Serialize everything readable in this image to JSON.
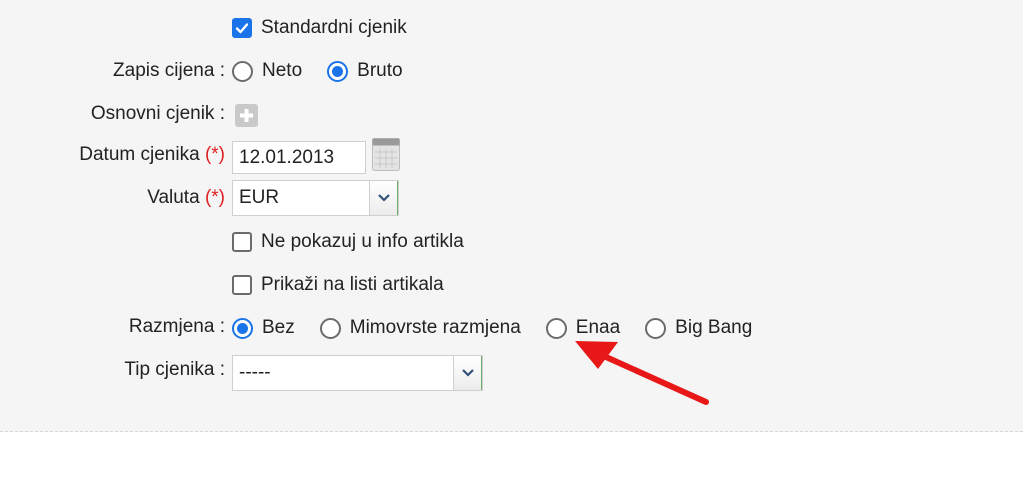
{
  "form": {
    "standardni_cjenik": {
      "label": "Standardni cjenik",
      "checked": true
    },
    "zapis_cijena": {
      "label": "Zapis cijena :",
      "options": [
        {
          "label": "Neto",
          "selected": false
        },
        {
          "label": "Bruto",
          "selected": true
        }
      ]
    },
    "osnovni_cjenik": {
      "label": "Osnovni cjenik :",
      "icon": "plus-icon"
    },
    "datum_cjenika": {
      "label": "Datum cjenika",
      "required_mark": "(*)",
      "colon": ":",
      "value": "12.01.2013",
      "icon": "calendar-icon"
    },
    "valuta": {
      "label": "Valuta",
      "required_mark": "(*)",
      "colon": ":",
      "value": "EUR"
    },
    "ne_pokazuj": {
      "label": "Ne pokazuj u info artikla",
      "checked": false
    },
    "prikazi": {
      "label": "Prikaži na listi artikala",
      "checked": false
    },
    "razmjena": {
      "label": "Razmjena :",
      "options": [
        {
          "label": "Bez",
          "selected": true
        },
        {
          "label": "Mimovrste razmjena",
          "selected": false
        },
        {
          "label": "Enaa",
          "selected": false
        },
        {
          "label": "Big Bang",
          "selected": false
        }
      ]
    },
    "tip_cjenika": {
      "label": "Tip cjenika :",
      "value": "-----"
    }
  },
  "colors": {
    "accent": "#1a73e8",
    "required": "#e02020",
    "annotation_arrow": "#e81818",
    "panel_bg": "#f5f5f5"
  }
}
